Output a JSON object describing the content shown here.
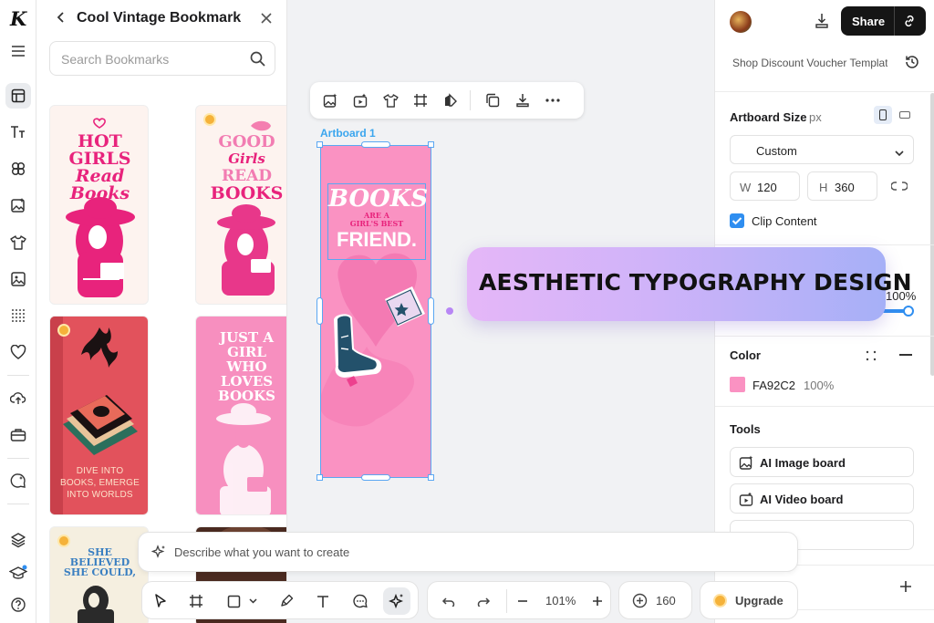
{
  "panel": {
    "title": "Cool Vintage Bookmark",
    "search_placeholder": "Search Bookmarks"
  },
  "templates": [
    {
      "name": "Hot Girls Read Books",
      "text": [
        "HOT",
        "GIRLS",
        "Read",
        "Books"
      ],
      "bg": "#fdf3ef",
      "premium": false
    },
    {
      "name": "Good Girls Read Books",
      "text": [
        "GOOD",
        "Girls",
        "READ",
        "BOOKS"
      ],
      "bg": "#fdf3ef",
      "premium": true
    },
    {
      "name": "Dive into books",
      "text": [
        "DIVE INTO",
        "BOOKS, EMERGE",
        "INTO WORLDS"
      ],
      "bg": "#e2525c",
      "premium": true
    },
    {
      "name": "Just a girl who loves books",
      "text": [
        "JUST A",
        "GIRL",
        "WHO",
        "LOVES",
        "BOOKS"
      ],
      "bg": "#f78fbf",
      "premium": false
    },
    {
      "name": "She believed she could",
      "text": [
        "SHE",
        "BELIEVED",
        "SHE COULD,"
      ],
      "bg": "#f5efe0",
      "premium": true
    },
    {
      "name": "Dark bookmark",
      "text": [],
      "bg": "#4a2a20",
      "premium": false
    }
  ],
  "canvas": {
    "artboard_label": "Artboard 1",
    "artboard_text": {
      "line1": "BOOKS",
      "line2": "ARE A",
      "line3": "GIRL'S BEST",
      "line4": "FRIEND."
    },
    "banner": "AESTHETIC TYPOGRAPHY DESIGN"
  },
  "right_panel": {
    "share_label": "Share",
    "doc_title": "Shop Discount Voucher Template",
    "artboard_size_label": "Artboard Size",
    "unit": "px",
    "preset": "Custom",
    "width_label": "W",
    "width_value": "120",
    "height_label": "H",
    "height_value": "360",
    "clip_label": "Clip Content",
    "opacity_value": "100%",
    "color_label": "Color",
    "color_hex": "FA92C2",
    "color_opacity": "100%",
    "tools_label": "Tools",
    "tools": [
      "AI Image board",
      "AI Video board"
    ]
  },
  "bottom": {
    "prompt_placeholder": "Describe what you want to create",
    "zoom": "101%",
    "credits": "160",
    "upgrade_label": "Upgrade"
  },
  "colors": {
    "accent_blue": "#3ba6ee",
    "artboard_fill": "#fa92c2",
    "share_bg": "#151515",
    "hot_pink": "#e8237c"
  }
}
